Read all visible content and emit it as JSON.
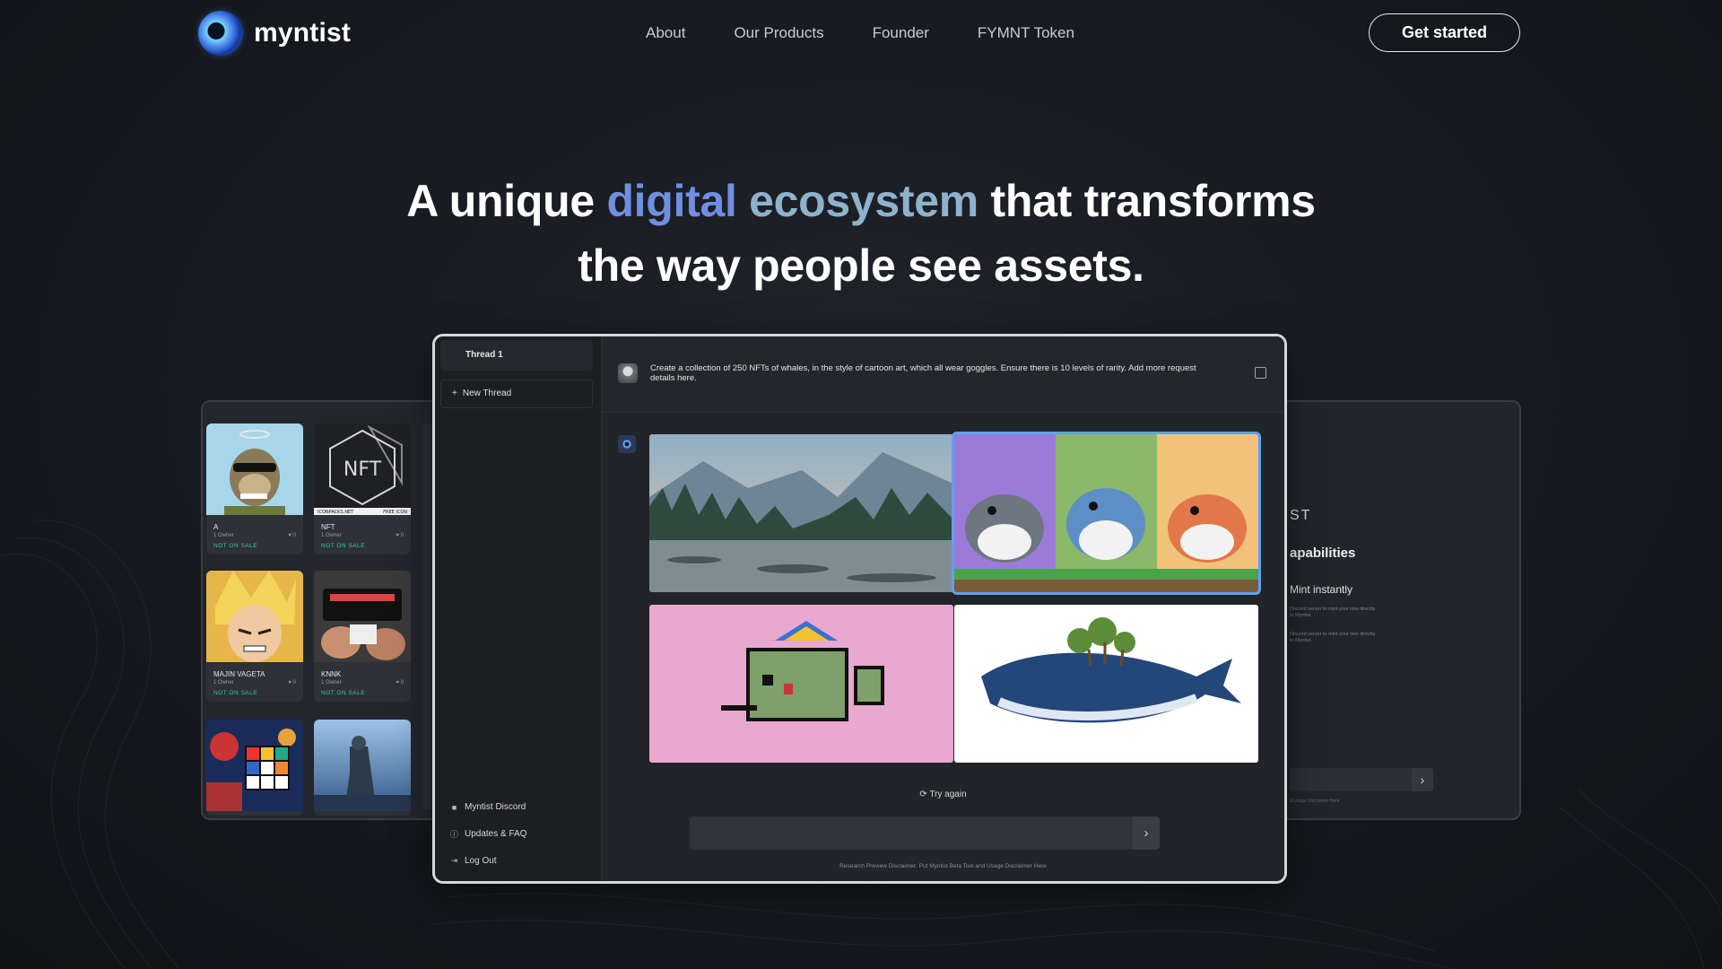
{
  "nav": {
    "brand": "myntist",
    "links": [
      "About",
      "Our Products",
      "Founder",
      "FYMNT Token"
    ],
    "cta_label": "Get started"
  },
  "hero": {
    "line1_prefix": "A unique ",
    "line1_highlight_a": "digital",
    "line1_highlight_b": "ecosystem",
    "line1_suffix": " that transforms",
    "line2": "the way people see assets.",
    "highlight_colors": {
      "digital": "#6f8fe0",
      "ecosystem": "#8fb2cc"
    }
  },
  "gallery": {
    "items": [
      {
        "title": "A",
        "owners": "1 Owner",
        "likes": "0",
        "status": "NOT ON SALE",
        "icon": "ape-cartoon"
      },
      {
        "title": "NFT",
        "owners": "1 Owner",
        "likes": "0",
        "status": "NOT ON SALE",
        "icon": "nft-logo",
        "banner_left": "ICONPACKS.NET",
        "banner_right": "FREE ICON"
      },
      {
        "title": "MAJIN VAGETA",
        "owners": "1 Owner",
        "likes": "0",
        "status": "NOT ON SALE",
        "icon": "anime-character"
      },
      {
        "title": "KNNK",
        "owners": "1 Owner",
        "likes": "0",
        "status": "NOT ON SALE",
        "icon": "cards-photo"
      },
      {
        "title": "",
        "owners": "",
        "likes": "",
        "status": "",
        "icon": "rubiks-cube"
      },
      {
        "title": "",
        "owners": "",
        "likes": "",
        "status": "",
        "icon": "soldier-game"
      }
    ]
  },
  "app": {
    "sidebar": {
      "thread": "Thread 1",
      "new_thread": "New Thread",
      "bottom": [
        {
          "label": "Myntist Discord",
          "icon": "discord-icon"
        },
        {
          "label": "Updates & FAQ",
          "icon": "info-icon"
        },
        {
          "label": "Log Out",
          "icon": "logout-icon"
        }
      ]
    },
    "prompt": "Create a collection of 250 NFTs of whales, in the style of cartoon art, which all wear goggles. Ensure there is 10 levels of rarity. Add more request details here.",
    "try_again": "Try again",
    "disclaimer": "Research Preview Disclaimer: Put Myntist Beta Tool and Usage Disclaimer Here"
  },
  "right_panel": {
    "title_fragment": "ST",
    "capabilities": "apabilities",
    "mint": "Mint instantly",
    "note_1": "Discord server to mint your one directly to Myntist.",
    "note_2": "Discord server to mint your one directly to Myntist.",
    "footer": "d Usage Disclaimer Here"
  }
}
